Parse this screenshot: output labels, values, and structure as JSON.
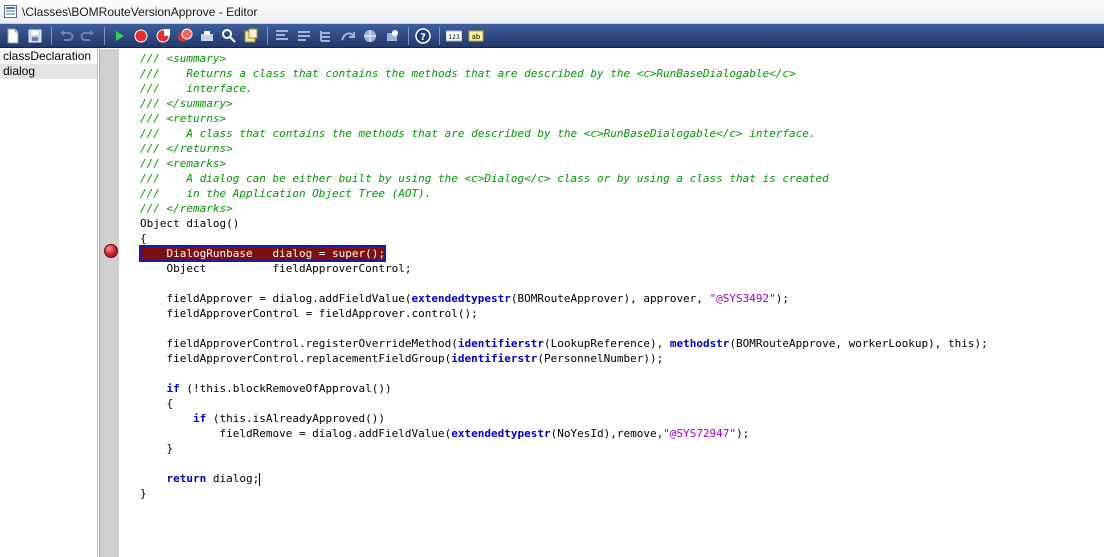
{
  "window": {
    "title": "\\Classes\\BOMRouteVersionApprove - Editor"
  },
  "toolbar": {
    "buttons": [
      {
        "name": "new-icon"
      },
      {
        "name": "save-icon"
      },
      {
        "name": "undo-icon"
      },
      {
        "name": "redo-icon"
      },
      {
        "name": "run-icon"
      },
      {
        "name": "toggle-breakpoint-icon"
      },
      {
        "name": "enable-breakpoint-icon"
      },
      {
        "name": "remove-breakpoints-icon"
      },
      {
        "name": "compile-icon"
      },
      {
        "name": "lookup-icon"
      },
      {
        "name": "script-icon"
      },
      {
        "name": "list-methods-icon"
      },
      {
        "name": "list-properties-icon"
      },
      {
        "name": "list-tables-icon"
      },
      {
        "name": "go-to-definition-icon"
      },
      {
        "name": "globe-icon"
      },
      {
        "name": "find-icon"
      },
      {
        "name": "help-icon"
      },
      {
        "name": "line-numbers-icon"
      },
      {
        "name": "spell-check-icon"
      }
    ]
  },
  "methods": {
    "items": [
      {
        "label": "classDeclaration"
      },
      {
        "label": "dialog"
      }
    ],
    "selected": "dialog"
  },
  "code": {
    "lines": [
      {
        "segments": [
          {
            "t": "cmt",
            "v": "/// <summary>"
          }
        ]
      },
      {
        "segments": [
          {
            "t": "cmt",
            "v": "///    Returns a class that contains the methods that are described by the <c>RunBaseDialogable</c>"
          }
        ]
      },
      {
        "segments": [
          {
            "t": "cmt",
            "v": "///    interface."
          }
        ]
      },
      {
        "segments": [
          {
            "t": "cmt",
            "v": "/// </summary>"
          }
        ]
      },
      {
        "segments": [
          {
            "t": "cmt",
            "v": "/// <returns>"
          }
        ]
      },
      {
        "segments": [
          {
            "t": "cmt",
            "v": "///    A class that contains the methods that are described by the <c>RunBaseDialogable</c> interface."
          }
        ]
      },
      {
        "segments": [
          {
            "t": "cmt",
            "v": "/// </returns>"
          }
        ]
      },
      {
        "segments": [
          {
            "t": "cmt",
            "v": "/// <remarks>"
          }
        ]
      },
      {
        "segments": [
          {
            "t": "cmt",
            "v": "///    A dialog can be either built by using the <c>Dialog</c> class or by using a class that is created"
          }
        ]
      },
      {
        "segments": [
          {
            "t": "cmt",
            "v": "///    in the Application Object Tree (AOT)."
          }
        ]
      },
      {
        "segments": [
          {
            "t": "cmt",
            "v": "/// </remarks>"
          }
        ]
      },
      {
        "segments": [
          {
            "t": "plain",
            "v": "Object dialog()"
          }
        ]
      },
      {
        "segments": [
          {
            "t": "plain",
            "v": "{"
          }
        ]
      },
      {
        "segments": [
          {
            "t": "hl",
            "v": "    DialogRunbase   dialog = super();"
          }
        ],
        "breakpoint": true
      },
      {
        "segments": [
          {
            "t": "plain",
            "v": "    Object          fieldApproverControl;"
          }
        ]
      },
      {
        "segments": [
          {
            "t": "plain",
            "v": ""
          }
        ]
      },
      {
        "segments": [
          {
            "t": "plain",
            "v": "    fieldApprover = dialog.addFieldValue("
          },
          {
            "t": "kw",
            "v": "extendedtypestr"
          },
          {
            "t": "plain",
            "v": "(BOMRouteApprover), approver, "
          },
          {
            "t": "str",
            "v": "\"@SYS3492\""
          },
          {
            "t": "plain",
            "v": ");"
          }
        ]
      },
      {
        "segments": [
          {
            "t": "plain",
            "v": "    fieldApproverControl = fieldApprover.control();"
          }
        ]
      },
      {
        "segments": [
          {
            "t": "plain",
            "v": ""
          }
        ]
      },
      {
        "segments": [
          {
            "t": "plain",
            "v": "    fieldApproverControl.registerOverrideMethod("
          },
          {
            "t": "kw",
            "v": "identifierstr"
          },
          {
            "t": "plain",
            "v": "(LookupReference), "
          },
          {
            "t": "kw",
            "v": "methodstr"
          },
          {
            "t": "plain",
            "v": "(BOMRouteApprove, workerLookup), this);"
          }
        ]
      },
      {
        "segments": [
          {
            "t": "plain",
            "v": "    fieldApproverControl.replacementFieldGroup("
          },
          {
            "t": "kw",
            "v": "identifierstr"
          },
          {
            "t": "plain",
            "v": "(PersonnelNumber));"
          }
        ]
      },
      {
        "segments": [
          {
            "t": "plain",
            "v": ""
          }
        ]
      },
      {
        "segments": [
          {
            "t": "plain",
            "v": "    "
          },
          {
            "t": "kw",
            "v": "if"
          },
          {
            "t": "plain",
            "v": " (!this.blockRemoveOfApproval())"
          }
        ]
      },
      {
        "segments": [
          {
            "t": "plain",
            "v": "    {"
          }
        ]
      },
      {
        "segments": [
          {
            "t": "plain",
            "v": "        "
          },
          {
            "t": "kw",
            "v": "if"
          },
          {
            "t": "plain",
            "v": " (this.isAlreadyApproved())"
          }
        ]
      },
      {
        "segments": [
          {
            "t": "plain",
            "v": "            fieldRemove = dialog.addFieldValue("
          },
          {
            "t": "kw",
            "v": "extendedtypestr"
          },
          {
            "t": "plain",
            "v": "(NoYesId),remove,"
          },
          {
            "t": "str",
            "v": "\"@SYS72947\""
          },
          {
            "t": "plain",
            "v": ");"
          }
        ]
      },
      {
        "segments": [
          {
            "t": "plain",
            "v": "    }"
          }
        ]
      },
      {
        "segments": [
          {
            "t": "plain",
            "v": ""
          }
        ]
      },
      {
        "segments": [
          {
            "t": "plain",
            "v": "    "
          },
          {
            "t": "kw",
            "v": "return"
          },
          {
            "t": "plain",
            "v": " dialog;"
          }
        ],
        "caret": true
      },
      {
        "segments": [
          {
            "t": "plain",
            "v": "}"
          }
        ]
      }
    ]
  },
  "colors": {
    "comment": "#009900",
    "keyword": "#0000cc",
    "string": "#9900cc",
    "highlight_bg": "#7c1010",
    "highlight_border": "#1a1aa8",
    "toolbar_bg": "#2b4679"
  }
}
